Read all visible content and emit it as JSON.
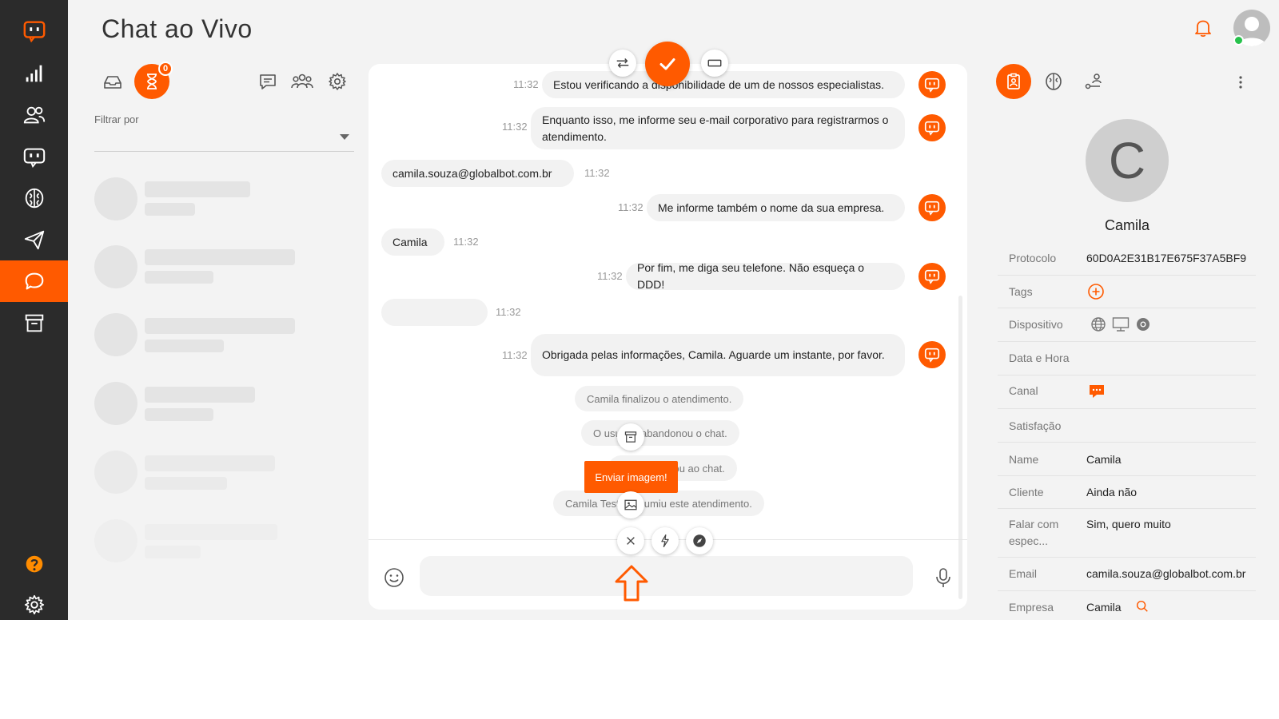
{
  "app": {
    "title": "Chat ao Vivo",
    "accent_color": "#ff5a00"
  },
  "nav": {
    "items": [
      {
        "icon": "logo-icon"
      },
      {
        "icon": "analytics-icon"
      },
      {
        "icon": "users-icon"
      },
      {
        "icon": "bots-icon"
      },
      {
        "icon": "brain-icon"
      },
      {
        "icon": "send-icon"
      },
      {
        "icon": "chat-icon",
        "active": true
      },
      {
        "icon": "archive-icon"
      }
    ],
    "bottom": [
      {
        "icon": "help-icon"
      },
      {
        "icon": "settings-icon"
      }
    ]
  },
  "list_panel": {
    "queue_badge": "0",
    "filter_label": "Filtrar por",
    "filter_value": ""
  },
  "chat": {
    "messages": [
      {
        "side": "bot",
        "time": "11:32",
        "text": "Estou verificando a disponibilidade de um de nossos especialistas."
      },
      {
        "side": "bot",
        "time": "11:32",
        "text": "Enquanto isso, me informe seu e-mail corporativo para registrarmos o atendimento."
      },
      {
        "side": "user",
        "time": "11:32",
        "text": "camila.souza@globalbot.com.br"
      },
      {
        "side": "bot",
        "time": "11:32",
        "text": "Me informe também o nome da sua empresa."
      },
      {
        "side": "user",
        "time": "11:32",
        "text": "Camila"
      },
      {
        "side": "bot",
        "time": "11:32",
        "text": "Por fim, me diga seu telefone. Não esqueça o DDD!"
      },
      {
        "side": "user",
        "time": "11:32",
        "text": ""
      },
      {
        "side": "bot",
        "time": "11:32",
        "text": "Obrigada pelas informações, Camila. Aguarde um instante, por favor."
      }
    ],
    "system_messages": [
      "Camila finalizou o atendimento.",
      "O usuário abandonou o chat.",
      "Camila entrou ao chat.",
      "Camila Teste assumiu este atendimento."
    ],
    "tooltip": "Enviar imagem!",
    "input_placeholder": ""
  },
  "contact": {
    "initial": "C",
    "name": "Camila",
    "fields": [
      {
        "label": "Protocolo",
        "value": "60D0A2E31B17E675F37A5BF9"
      },
      {
        "label": "Tags",
        "value": ""
      },
      {
        "label": "Dispositivo",
        "value": ""
      },
      {
        "label": "Data e Hora",
        "value": ""
      },
      {
        "label": "Canal",
        "value": ""
      },
      {
        "label": "Satisfação",
        "value": ""
      },
      {
        "label": "Name",
        "value": "Camila"
      },
      {
        "label": "Cliente",
        "value": "Ainda não"
      },
      {
        "label": "Falar com espec...",
        "value": "Sim, quero muito"
      },
      {
        "label": "Email",
        "value": "camila.souza@globalbot.com.br"
      },
      {
        "label": "Empresa",
        "value": "Camila"
      }
    ]
  }
}
